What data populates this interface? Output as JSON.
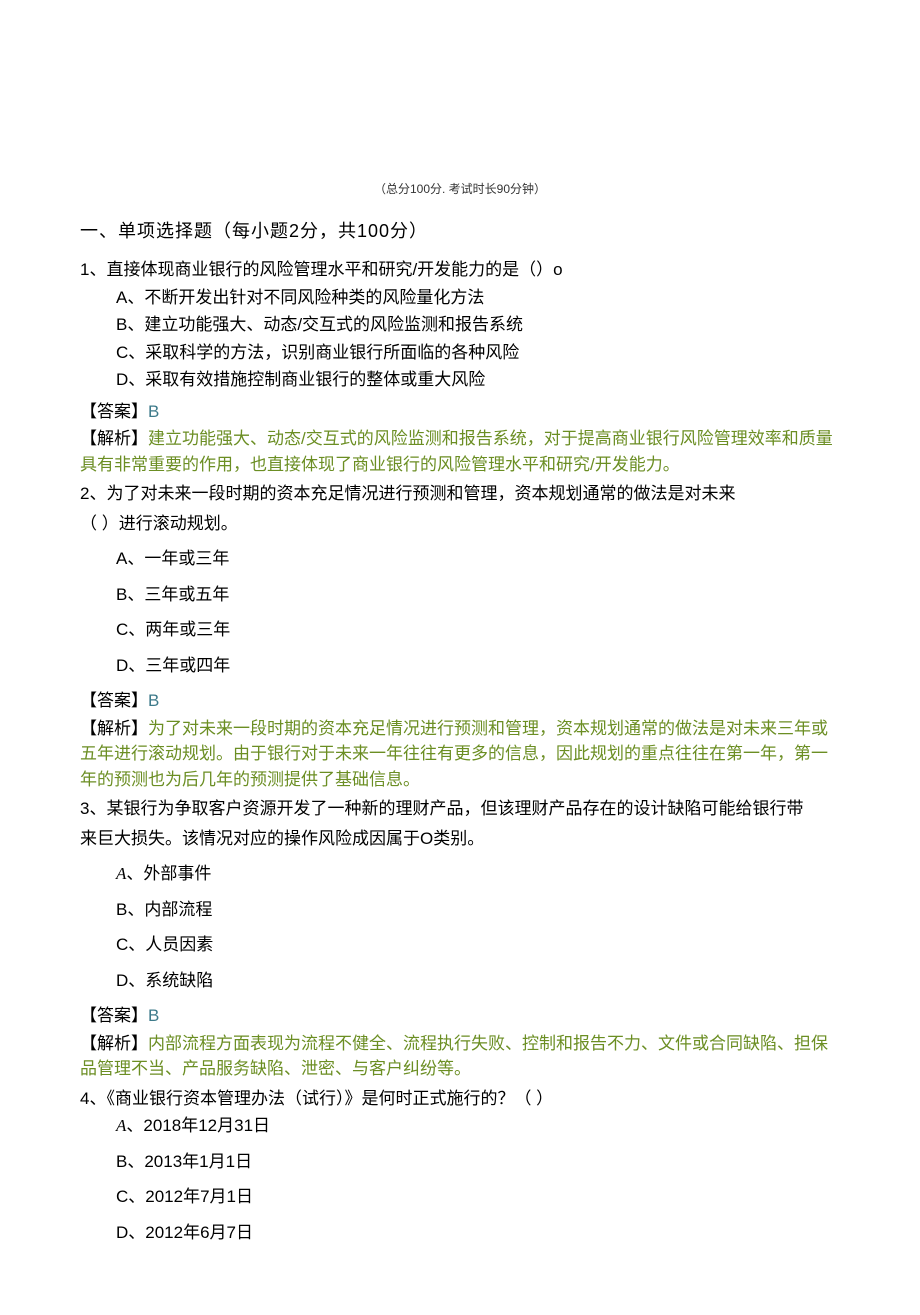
{
  "header": {
    "exam_info": "（总分100分. 考试时长90分钟）"
  },
  "section": {
    "title": "一、单项选择题（每小题2分，共100分）"
  },
  "labels": {
    "answer": "【答案】",
    "explain": "【解析】"
  },
  "q1": {
    "stem": "1、直接体现商业银行的风险管理水平和研究/开发能力的是（）o",
    "A": "A、不断开发出针对不同风险种类的风险量化方法",
    "B": "B、建立功能强大、动态/交互式的风险监测和报告系统",
    "C": "C、采取科学的方法，识别商业银行所面临的各种风险",
    "D": "D、采取有效措施控制商业银行的整体或重大风险",
    "ans": "B",
    "exp": "建立功能强大、动态/交互式的风险监测和报告系统，对于提高商业银行风险管理效率和质量具有非常重要的作用，也直接体现了商业银行的风险管理水平和研究/开发能力。"
  },
  "q2": {
    "stem_l1": "2、为了对未来一段时期的资本充足情况进行预测和管理，资本规划通常的做法是对未来",
    "stem_l2": "（    ）进行滚动规划。",
    "A": "A、一年或三年",
    "B": "B、三年或五年",
    "C": "C、两年或三年",
    "D": "D、三年或四年",
    "ans": "B",
    "exp": "为了对未来一段时期的资本充足情况进行预测和管理，资本规划通常的做法是对未来三年或五年进行滚动规划。由于银行对于未来一年往往有更多的信息，因此规划的重点往往在第一年，第一年的预测也为后几年的预测提供了基础信息。"
  },
  "q3": {
    "stem_l1": "3、某银行为争取客户资源开发了一种新的理财产品，但该理财产品存在的设计缺陷可能给银行带",
    "stem_l2": "来巨大损失。该情况对应的操作风险成因属于O类别。",
    "A_prefix": "A",
    "A_rest": "、外部事件",
    "B": "B、内部流程",
    "C": "C、人员因素",
    "D": "D、系统缺陷",
    "ans": "B",
    "exp": "内部流程方面表现为流程不健全、流程执行失败、控制和报告不力、文件或合同缺陷、担保品管理不当、产品服务缺陷、泄密、与客户纠纷等。"
  },
  "q4": {
    "stem": "4、《商业银行资本管理办法（试行）》是何时正式施行的？（      ）",
    "A_prefix": "A",
    "A_rest": "、2018年12月31日",
    "B": "B、2013年1月1日",
    "C": "C、2012年7月1日",
    "D": "D、2012年6月7日"
  }
}
